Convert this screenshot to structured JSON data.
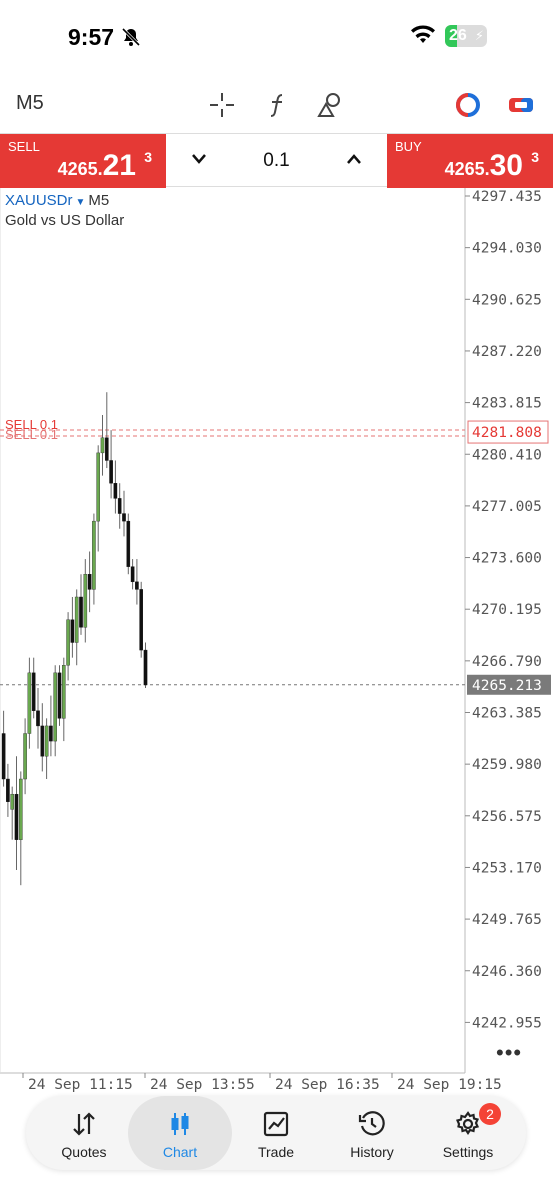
{
  "status_bar": {
    "time": "9:57",
    "battery": "26"
  },
  "toolbar": {
    "timeframe": "M5"
  },
  "trade": {
    "sell_label": "SELL",
    "sell_price_main": "4265.",
    "sell_price_big": "21",
    "sell_price_sup": "3",
    "buy_label": "BUY",
    "buy_price_main": "4265.",
    "buy_price_big": "30",
    "buy_price_sup": "3",
    "lot": "0.1"
  },
  "chart_info": {
    "symbol": "XAUUSDr",
    "timeframe": "M5",
    "description": "Gold vs US Dollar"
  },
  "chart_data": {
    "type": "candlestick",
    "price_axis": [
      "4297.435",
      "4294.030",
      "4290.625",
      "4287.220",
      "4283.815",
      "4280.410",
      "4277.005",
      "4273.600",
      "4270.195",
      "4266.790",
      "4263.385",
      "4259.980",
      "4256.575",
      "4253.170",
      "4249.765",
      "4246.360",
      "4242.955"
    ],
    "time_axis": [
      "24 Sep 11:15",
      "24 Sep 13:55",
      "24 Sep 16:35",
      "24 Sep 19:15"
    ],
    "current_price": "4265.213",
    "order_line": {
      "label": "SELL 0.1",
      "price": "4281.808"
    },
    "candles": [
      {
        "o": 4262.0,
        "h": 4263.5,
        "l": 4258.5,
        "c": 4259.0
      },
      {
        "o": 4259.0,
        "h": 4260.0,
        "l": 4256.5,
        "c": 4257.5
      },
      {
        "o": 4257.0,
        "h": 4258.5,
        "l": 4255.0,
        "c": 4258.0
      },
      {
        "o": 4258.0,
        "h": 4260.5,
        "l": 4253.0,
        "c": 4255.0
      },
      {
        "o": 4255.0,
        "h": 4259.5,
        "l": 4252.0,
        "c": 4259.0
      },
      {
        "o": 4259.0,
        "h": 4263.0,
        "l": 4258.0,
        "c": 4262.0
      },
      {
        "o": 4262.0,
        "h": 4267.0,
        "l": 4261.0,
        "c": 4266.0
      },
      {
        "o": 4266.0,
        "h": 4267.0,
        "l": 4263.0,
        "c": 4263.5
      },
      {
        "o": 4263.5,
        "h": 4265.0,
        "l": 4261.0,
        "c": 4262.5
      },
      {
        "o": 4262.5,
        "h": 4264.0,
        "l": 4259.5,
        "c": 4260.5
      },
      {
        "o": 4260.5,
        "h": 4263.0,
        "l": 4259.0,
        "c": 4262.5
      },
      {
        "o": 4262.5,
        "h": 4264.5,
        "l": 4260.5,
        "c": 4261.5
      },
      {
        "o": 4261.5,
        "h": 4266.5,
        "l": 4260.5,
        "c": 4266.0
      },
      {
        "o": 4266.0,
        "h": 4266.5,
        "l": 4262.5,
        "c": 4263.0
      },
      {
        "o": 4263.0,
        "h": 4267.0,
        "l": 4261.5,
        "c": 4266.5
      },
      {
        "o": 4266.5,
        "h": 4270.0,
        "l": 4265.5,
        "c": 4269.5
      },
      {
        "o": 4269.5,
        "h": 4271.0,
        "l": 4267.0,
        "c": 4268.0
      },
      {
        "o": 4268.0,
        "h": 4271.5,
        "l": 4266.5,
        "c": 4271.0
      },
      {
        "o": 4271.0,
        "h": 4272.5,
        "l": 4268.5,
        "c": 4269.0
      },
      {
        "o": 4269.0,
        "h": 4273.5,
        "l": 4268.0,
        "c": 4272.5
      },
      {
        "o": 4272.5,
        "h": 4274.0,
        "l": 4270.0,
        "c": 4271.5
      },
      {
        "o": 4271.5,
        "h": 4276.5,
        "l": 4270.5,
        "c": 4276.0
      },
      {
        "o": 4276.0,
        "h": 4281.0,
        "l": 4274.0,
        "c": 4280.5
      },
      {
        "o": 4280.5,
        "h": 4283.0,
        "l": 4279.0,
        "c": 4281.5
      },
      {
        "o": 4281.5,
        "h": 4284.5,
        "l": 4279.5,
        "c": 4280.0
      },
      {
        "o": 4280.0,
        "h": 4282.0,
        "l": 4277.5,
        "c": 4278.5
      },
      {
        "o": 4278.5,
        "h": 4280.0,
        "l": 4276.5,
        "c": 4277.5
      },
      {
        "o": 4277.5,
        "h": 4278.5,
        "l": 4275.5,
        "c": 4276.5
      },
      {
        "o": 4276.5,
        "h": 4278.0,
        "l": 4275.0,
        "c": 4276.0
      },
      {
        "o": 4276.0,
        "h": 4276.5,
        "l": 4272.5,
        "c": 4273.0
      },
      {
        "o": 4273.0,
        "h": 4273.5,
        "l": 4271.5,
        "c": 4272.0
      },
      {
        "o": 4272.0,
        "h": 4273.5,
        "l": 4270.5,
        "c": 4271.5
      },
      {
        "o": 4271.5,
        "h": 4272.0,
        "l": 4267.0,
        "c": 4267.5
      },
      {
        "o": 4267.5,
        "h": 4268.0,
        "l": 4265.0,
        "c": 4265.2
      }
    ]
  },
  "nav": {
    "quotes": "Quotes",
    "chart": "Chart",
    "trade": "Trade",
    "history": "History",
    "settings": "Settings",
    "settings_badge": "2"
  },
  "colors": {
    "sell": "#e53935",
    "buy": "#e53935",
    "bull": "#6aa84f",
    "bear": "#111111",
    "accent": "#1e88e5"
  }
}
